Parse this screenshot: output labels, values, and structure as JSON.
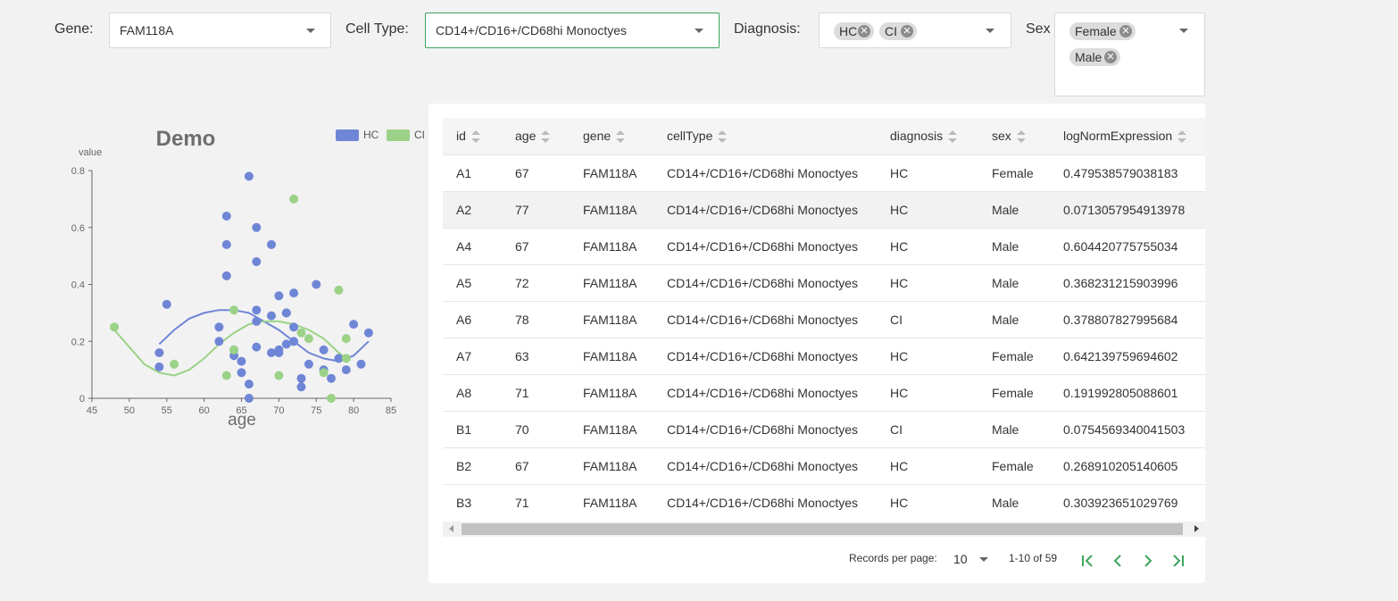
{
  "filters": {
    "gene": {
      "label": "Gene:",
      "value": "FAM118A"
    },
    "cell_type": {
      "label": "Cell Type:",
      "value": "CD14+/CD16+/CD68hi Monoctyes"
    },
    "diagnosis": {
      "label": "Diagnosis:",
      "chips": [
        "HC",
        "CI"
      ]
    },
    "sex": {
      "label": "Sex",
      "chips": [
        "Female",
        "Male"
      ]
    }
  },
  "colors": {
    "accent": "#3ca55c",
    "hc": "#6f86d6",
    "ci": "#9bd287"
  },
  "chart_data": {
    "type": "scatter",
    "title": "Demo",
    "xlabel": "age",
    "ylabel": "value",
    "xlim": [
      45,
      85
    ],
    "ylim": [
      0,
      0.8
    ],
    "xticks": [
      45,
      50,
      55,
      60,
      65,
      70,
      75,
      80,
      85
    ],
    "yticks": [
      0,
      0.2,
      0.4,
      0.6,
      0.8
    ],
    "ytick_labels": [
      "0",
      "0.2",
      "0.4",
      "0.6",
      "0.8"
    ],
    "grid": false,
    "legend": "top-right",
    "series": [
      {
        "name": "HC",
        "color": "#6f86d6",
        "points": [
          [
            54,
            0.16
          ],
          [
            54,
            0.11
          ],
          [
            55,
            0.33
          ],
          [
            62,
            0.25
          ],
          [
            62,
            0.2
          ],
          [
            63,
            0.64
          ],
          [
            63,
            0.54
          ],
          [
            63,
            0.43
          ],
          [
            64,
            0.15
          ],
          [
            64,
            0.17
          ],
          [
            65,
            0.13
          ],
          [
            65,
            0.09
          ],
          [
            66,
            0.78
          ],
          [
            66,
            0.05
          ],
          [
            66,
            0.0
          ],
          [
            67,
            0.6
          ],
          [
            67,
            0.48
          ],
          [
            67,
            0.31
          ],
          [
            67,
            0.27
          ],
          [
            67,
            0.18
          ],
          [
            69,
            0.54
          ],
          [
            69,
            0.29
          ],
          [
            69,
            0.16
          ],
          [
            70,
            0.36
          ],
          [
            70,
            0.17
          ],
          [
            70,
            0.16
          ],
          [
            71,
            0.3
          ],
          [
            71,
            0.3
          ],
          [
            71,
            0.19
          ],
          [
            72,
            0.37
          ],
          [
            72,
            0.25
          ],
          [
            72,
            0.2
          ],
          [
            73,
            0.07
          ],
          [
            73,
            0.04
          ],
          [
            74,
            0.12
          ],
          [
            75,
            0.4
          ],
          [
            76,
            0.17
          ],
          [
            76,
            0.1
          ],
          [
            77,
            0.07
          ],
          [
            78,
            0.14
          ],
          [
            79,
            0.1
          ],
          [
            80,
            0.26
          ],
          [
            81,
            0.12
          ],
          [
            82,
            0.23
          ]
        ]
      },
      {
        "name": "CI",
        "color": "#9bd287",
        "points": [
          [
            48,
            0.25
          ],
          [
            56,
            0.12
          ],
          [
            63,
            0.08
          ],
          [
            64,
            0.31
          ],
          [
            64,
            0.17
          ],
          [
            70,
            0.08
          ],
          [
            72,
            0.7
          ],
          [
            73,
            0.23
          ],
          [
            74,
            0.21
          ],
          [
            76,
            0.09
          ],
          [
            77,
            0.0
          ],
          [
            78,
            0.38
          ],
          [
            79,
            0.21
          ],
          [
            79,
            0.14
          ]
        ]
      }
    ],
    "trend_lines": [
      {
        "name": "HC",
        "points": [
          [
            54,
            0.19
          ],
          [
            56,
            0.24
          ],
          [
            58,
            0.28
          ],
          [
            60,
            0.3
          ],
          [
            62,
            0.31
          ],
          [
            64,
            0.31
          ],
          [
            66,
            0.3
          ],
          [
            68,
            0.27
          ],
          [
            70,
            0.24
          ],
          [
            72,
            0.2
          ],
          [
            74,
            0.16
          ],
          [
            76,
            0.14
          ],
          [
            78,
            0.13
          ],
          [
            80,
            0.15
          ],
          [
            82,
            0.2
          ]
        ]
      },
      {
        "name": "CI",
        "points": [
          [
            48,
            0.24
          ],
          [
            50,
            0.18
          ],
          [
            52,
            0.12
          ],
          [
            54,
            0.09
          ],
          [
            56,
            0.08
          ],
          [
            58,
            0.1
          ],
          [
            60,
            0.14
          ],
          [
            62,
            0.19
          ],
          [
            64,
            0.23
          ],
          [
            66,
            0.26
          ],
          [
            68,
            0.27
          ],
          [
            70,
            0.27
          ],
          [
            72,
            0.26
          ],
          [
            74,
            0.24
          ],
          [
            76,
            0.21
          ],
          [
            78,
            0.16
          ],
          [
            79,
            0.14
          ]
        ]
      }
    ]
  },
  "table": {
    "columns": [
      "id",
      "age",
      "gene",
      "cellType",
      "diagnosis",
      "sex",
      "logNormExpression"
    ],
    "rows": [
      [
        "A1",
        "67",
        "FAM118A",
        "CD14+/CD16+/CD68hi Monoctyes",
        "HC",
        "Female",
        "0.479538579038183"
      ],
      [
        "A2",
        "77",
        "FAM118A",
        "CD14+/CD16+/CD68hi Monoctyes",
        "HC",
        "Male",
        "0.0713057954913978"
      ],
      [
        "A4",
        "67",
        "FAM118A",
        "CD14+/CD16+/CD68hi Monoctyes",
        "HC",
        "Male",
        "0.604420775755034"
      ],
      [
        "A5",
        "72",
        "FAM118A",
        "CD14+/CD16+/CD68hi Monoctyes",
        "HC",
        "Male",
        "0.368231215903996"
      ],
      [
        "A6",
        "78",
        "FAM118A",
        "CD14+/CD16+/CD68hi Monoctyes",
        "CI",
        "Male",
        "0.378807827995684"
      ],
      [
        "A7",
        "63",
        "FAM118A",
        "CD14+/CD16+/CD68hi Monoctyes",
        "HC",
        "Female",
        "0.642139759694602"
      ],
      [
        "A8",
        "71",
        "FAM118A",
        "CD14+/CD16+/CD68hi Monoctyes",
        "HC",
        "Female",
        "0.191992805088601"
      ],
      [
        "B1",
        "70",
        "FAM118A",
        "CD14+/CD16+/CD68hi Monoctyes",
        "CI",
        "Male",
        "0.0754569340041503"
      ],
      [
        "B2",
        "67",
        "FAM118A",
        "CD14+/CD16+/CD68hi Monoctyes",
        "HC",
        "Female",
        "0.268910205140605"
      ],
      [
        "B3",
        "71",
        "FAM118A",
        "CD14+/CD16+/CD68hi Monoctyes",
        "HC",
        "Male",
        "0.303923651029769"
      ]
    ],
    "highlighted_row": 1
  },
  "pagination": {
    "records_label": "Records per page:",
    "per_page": "10",
    "range": "1-10 of 59",
    "icons": [
      "first-page-icon",
      "prev-page-icon",
      "next-page-icon",
      "last-page-icon"
    ]
  }
}
